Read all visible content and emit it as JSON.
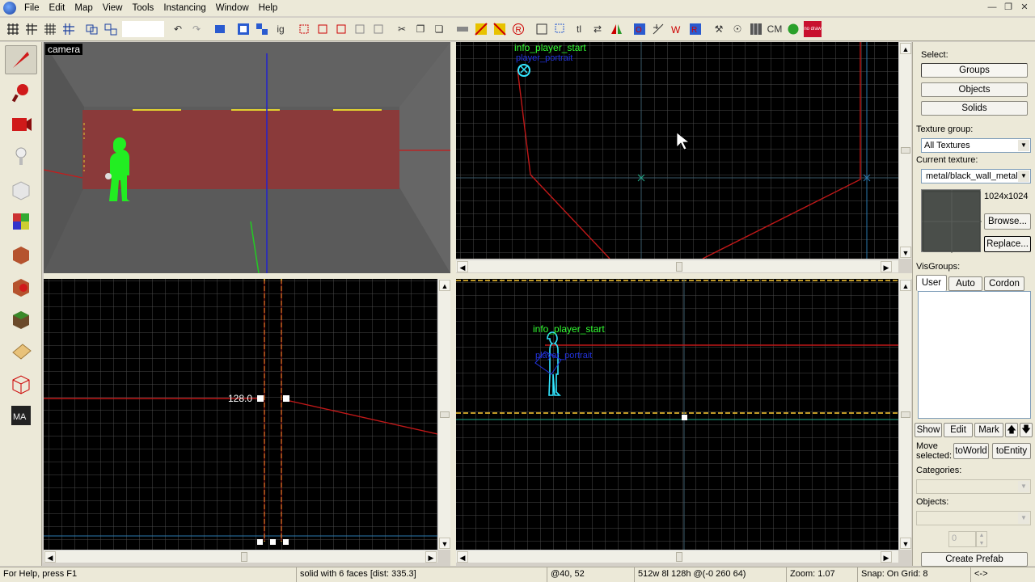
{
  "menus": [
    "File",
    "Edit",
    "Map",
    "View",
    "Tools",
    "Instancing",
    "Window",
    "Help"
  ],
  "toolbar": {
    "icons": [
      "grid-icon",
      "grid-dots-icon",
      "grid-icon",
      "grid-plus-icon",
      "group-icon",
      "ungroup-icon",
      "undo-icon",
      "redo-icon",
      "carve-icon",
      "select-icon",
      "cube-icon",
      "cube-icon",
      "cube-icon",
      "cube-icon",
      "cut-icon",
      "copy-icon",
      "paste-icon",
      "texture-icon",
      "texture-icon",
      "texture-icon",
      "texture-icon",
      "box-icon",
      "select-icon",
      "text-icon",
      "move-icon",
      "flip-icon",
      "toggle-icon",
      "measure-icon",
      "wireframe-icon",
      "wireframe-icon",
      "wrench-icon",
      "eye-icon",
      "texture-icon",
      "cm-icon",
      "leaf-icon",
      "nodraw-icon"
    ],
    "text_tl": "tl",
    "text_ig": "ig",
    "text_cm": "CM",
    "text_nodraw": "no draw"
  },
  "left_tools": [
    "selection-tool-icon",
    "magnify-tool-icon",
    "camera-tool-icon",
    "entity-tool-icon",
    "block-tool-icon",
    "texture-application-icon",
    "apply-texture-icon",
    "decal-icon",
    "overlay-icon",
    "clipping-icon",
    "vertex-icon",
    "maya-icon"
  ],
  "viewports": {
    "camera_label": "camera",
    "top_entity": "info_player_start",
    "top_entity2": "player_portrait",
    "side_entity": "info_player_start",
    "side_entity2": "player_portrait",
    "front_dim": "128.0"
  },
  "right_panel": {
    "select_label": "Select:",
    "groups": "Groups",
    "objects": "Objects",
    "solids": "Solids",
    "texture_group_label": "Texture group:",
    "texture_group_value": "All Textures",
    "current_texture_label": "Current texture:",
    "current_texture_value": "metal/black_wall_metal",
    "texture_size": "1024x1024",
    "browse": "Browse...",
    "replace": "Replace...",
    "visgroups_label": "VisGroups:",
    "tabs": [
      "User",
      "Auto",
      "Cordon"
    ],
    "show": "Show",
    "edit": "Edit",
    "mark": "Mark",
    "move_selected": "Move selected:",
    "to_world": "toWorld",
    "to_entity": "toEntity",
    "categories_label": "Categories:",
    "objects_label": "Objects:",
    "spinner_value": "0",
    "create_prefab": "Create Prefab"
  },
  "status": {
    "help": "For Help, press F1",
    "selection": "solid with 6 faces   [dist: 335.3]",
    "coords": "@40, 52",
    "size": "512w 8l 128h @(-0 260 64)",
    "zoom": "Zoom: 1.07",
    "snap": "Snap: On Grid: 8",
    "arrow": "<->"
  },
  "colors": {
    "grid": "#4a4a4a",
    "brush": "#c01818",
    "entity": "#33e6ff",
    "selection": "#ffcc33",
    "label_green": "#33ff33"
  }
}
